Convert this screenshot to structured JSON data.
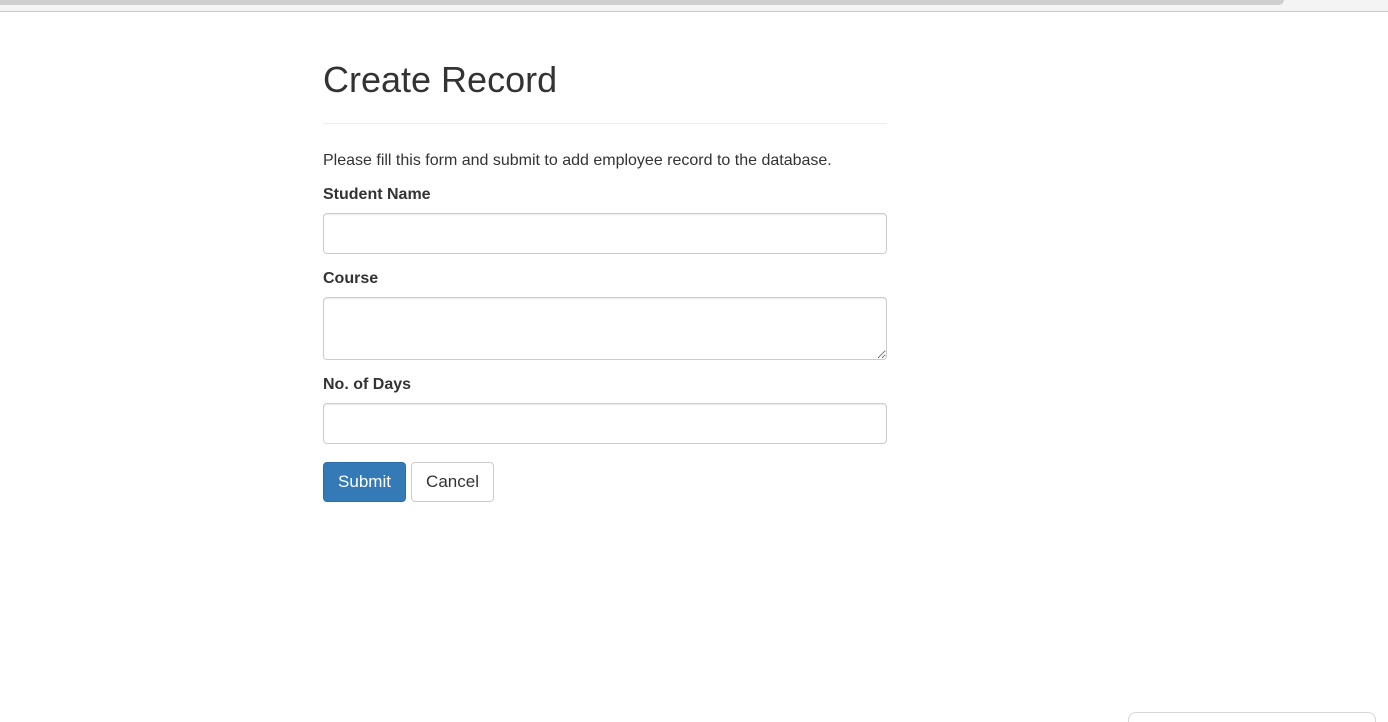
{
  "page": {
    "title": "Create Record",
    "intro": "Please fill this form and submit to add employee record to the database."
  },
  "form": {
    "student_name": {
      "label": "Student Name",
      "value": ""
    },
    "course": {
      "label": "Course",
      "value": ""
    },
    "days": {
      "label": "No. of Days",
      "value": ""
    },
    "submit_label": "Submit",
    "cancel_label": "Cancel"
  },
  "colors": {
    "primary": "#337ab7",
    "text": "#333333",
    "border": "#cccccc"
  }
}
